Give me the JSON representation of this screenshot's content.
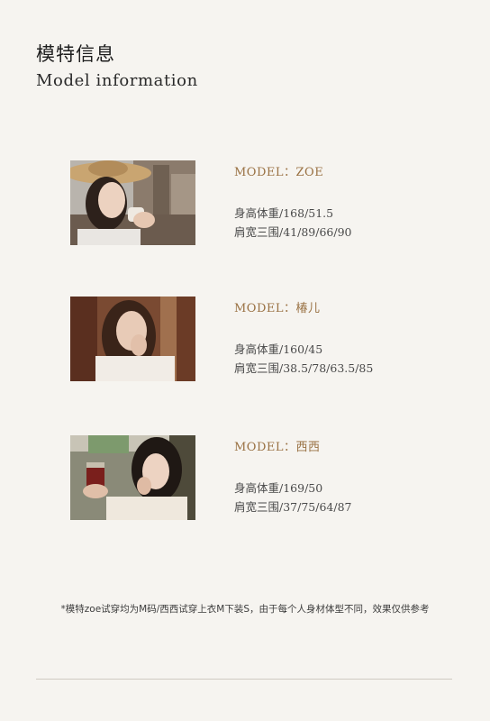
{
  "header": {
    "title_cn": "模特信息",
    "title_en": "Model information"
  },
  "models": [
    {
      "name": "MODEL：ZOE",
      "height_weight": "身高体重/168/51.5",
      "measurements": "肩宽三围/41/89/66/90"
    },
    {
      "name": "MODEL：椿儿",
      "height_weight": "身高体重/160/45",
      "measurements": "肩宽三围/38.5/78/63.5/85"
    },
    {
      "name": "MODEL：西西",
      "height_weight": "身高体重/169/50",
      "measurements": "肩宽三围/37/75/64/87"
    }
  ],
  "footer": {
    "note": "*模特zoe试穿均为M码/西西试穿上衣M下装S，由于每个人身材体型不同，效果仅供参考"
  }
}
